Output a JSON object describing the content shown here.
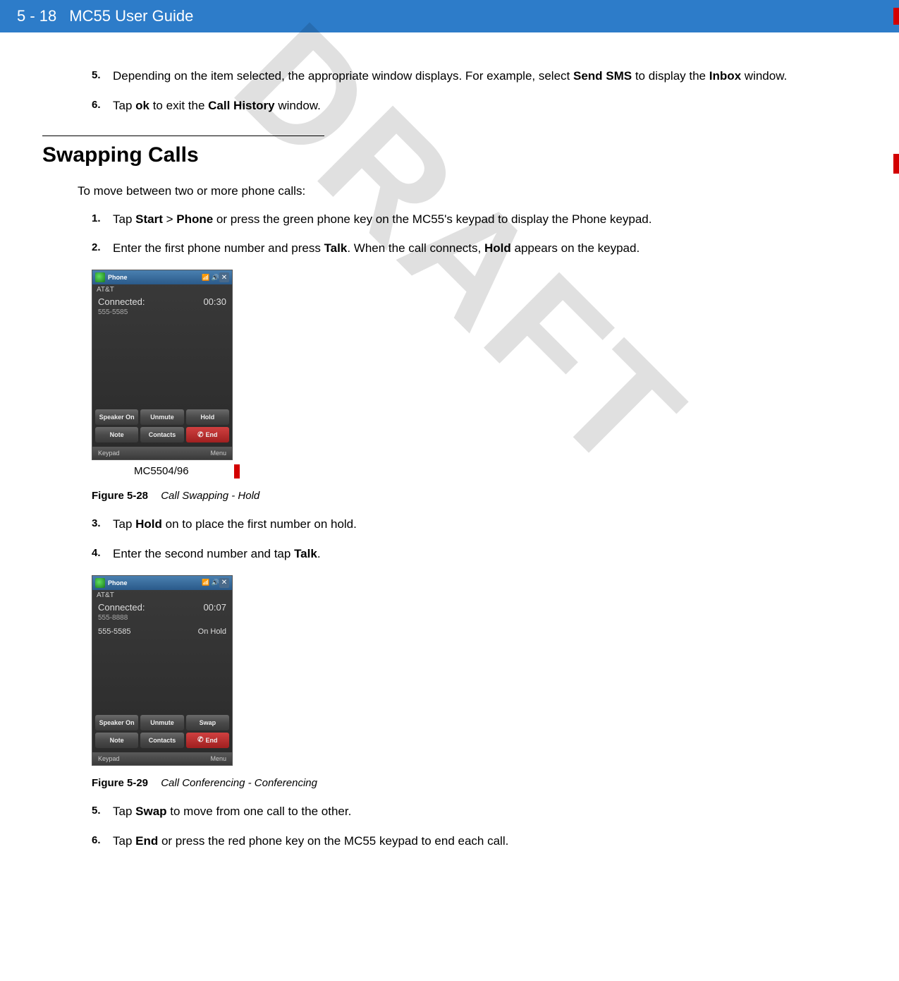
{
  "header": {
    "page": "5 - 18",
    "title": "MC55 User Guide"
  },
  "watermark": "DRAFT",
  "intro_steps": [
    {
      "num": "5.",
      "pre": "Depending on the item selected, the appropriate window displays. For example, select ",
      "b1": "Send SMS",
      "mid": " to display the ",
      "b2": "Inbox",
      "post": " window."
    },
    {
      "num": "6.",
      "pre": "Tap ",
      "b1": "ok",
      "mid": " to exit the ",
      "b2": "Call History",
      "post": " window."
    }
  ],
  "section_title": "Swapping Calls",
  "section_intro": "To move between two or more phone calls:",
  "steps_a": [
    {
      "num": "1.",
      "pre": "Tap ",
      "b1": "Start",
      "mid": " > ",
      "b2": "Phone",
      "post": " or press the green phone key on the MC55's keypad to display the Phone keypad."
    },
    {
      "num": "2.",
      "pre": "Enter the first phone number and press ",
      "b1": "Talk",
      "mid": ". When the call connects, ",
      "b2": "Hold",
      "post": " appears on the keypad."
    }
  ],
  "phone1": {
    "top_title": "Phone",
    "carrier": "AT&T",
    "status": "Connected:",
    "timer": "00:30",
    "number": "555-5585",
    "buttons_row1": [
      "Speaker On",
      "Unmute",
      "Hold"
    ],
    "buttons_row2": [
      "Note",
      "Contacts",
      "End"
    ],
    "bottom_left": "Keypad",
    "bottom_right": "Menu"
  },
  "sublabel1": "MC5504/96",
  "figure1": {
    "label": "Figure 5-28",
    "text": "Call Swapping - Hold"
  },
  "steps_b": [
    {
      "num": "3.",
      "pre": "Tap ",
      "b1": "Hold",
      "mid": " on to place the first number on hold.",
      "b2": "",
      "post": ""
    },
    {
      "num": "4.",
      "pre": "Enter the second number and tap ",
      "b1": "Talk",
      "mid": ".",
      "b2": "",
      "post": ""
    }
  ],
  "phone2": {
    "top_title": "Phone",
    "carrier": "AT&T",
    "status": "Connected:",
    "timer": "00:07",
    "number": "555-8888",
    "hold_number": "555-5585",
    "hold_status": "On Hold",
    "buttons_row1": [
      "Speaker On",
      "Unmute",
      "Swap"
    ],
    "buttons_row2": [
      "Note",
      "Contacts",
      "End"
    ],
    "bottom_left": "Keypad",
    "bottom_right": "Menu"
  },
  "figure2": {
    "label": "Figure 5-29",
    "text": "Call Conferencing - Conferencing"
  },
  "steps_c": [
    {
      "num": "5.",
      "pre": "Tap ",
      "b1": "Swap",
      "mid": " to move from one call to the other.",
      "b2": "",
      "post": ""
    },
    {
      "num": "6.",
      "pre": "Tap ",
      "b1": "End",
      "mid": " or press the red phone key on the MC55 keypad to end each call.",
      "b2": "",
      "post": ""
    }
  ]
}
